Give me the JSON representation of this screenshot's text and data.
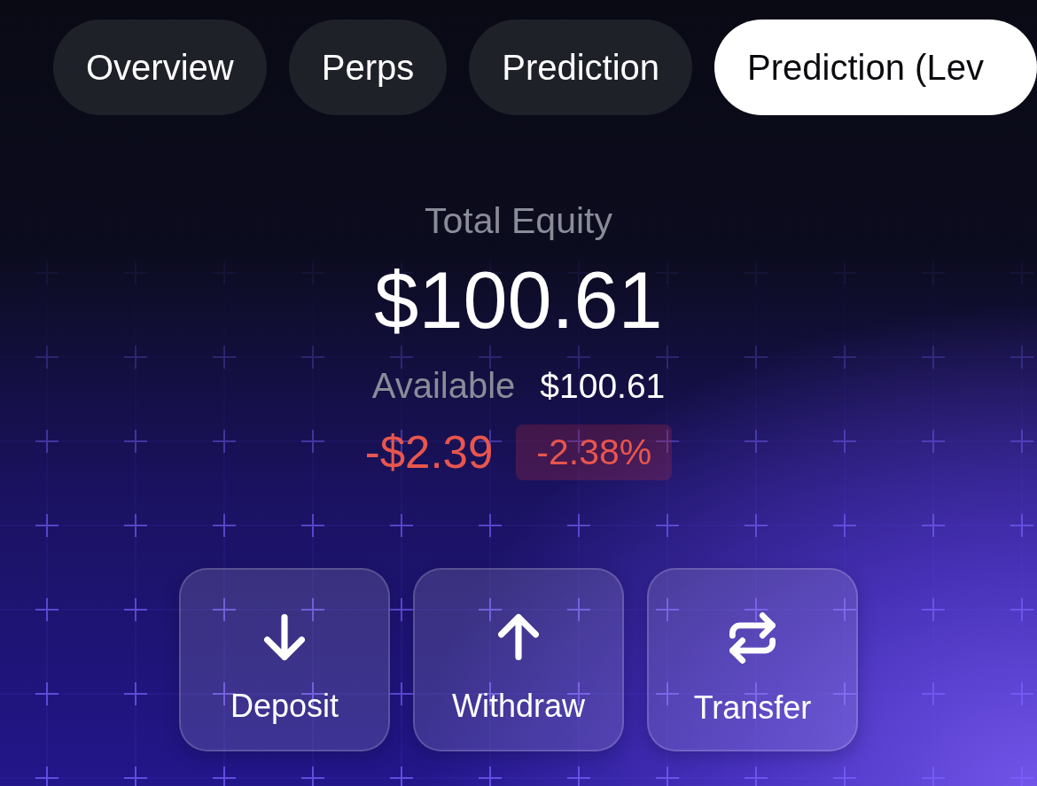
{
  "tabs": [
    {
      "label": "Overview",
      "selected": false
    },
    {
      "label": "Perps",
      "selected": false
    },
    {
      "label": "Prediction",
      "selected": false
    },
    {
      "label": "Prediction (Lev",
      "selected": true
    }
  ],
  "equity": {
    "label": "Total Equity",
    "value": "$100.61",
    "available_label": "Available",
    "available_value": "$100.61",
    "change": {
      "amount": "-$2.39",
      "percent": "-2.38%",
      "negative": true
    }
  },
  "actions": [
    {
      "label": "Deposit",
      "kind": "deposit"
    },
    {
      "label": "Withdraw",
      "kind": "withdraw"
    },
    {
      "label": "Transfer",
      "kind": "transfer"
    }
  ]
}
